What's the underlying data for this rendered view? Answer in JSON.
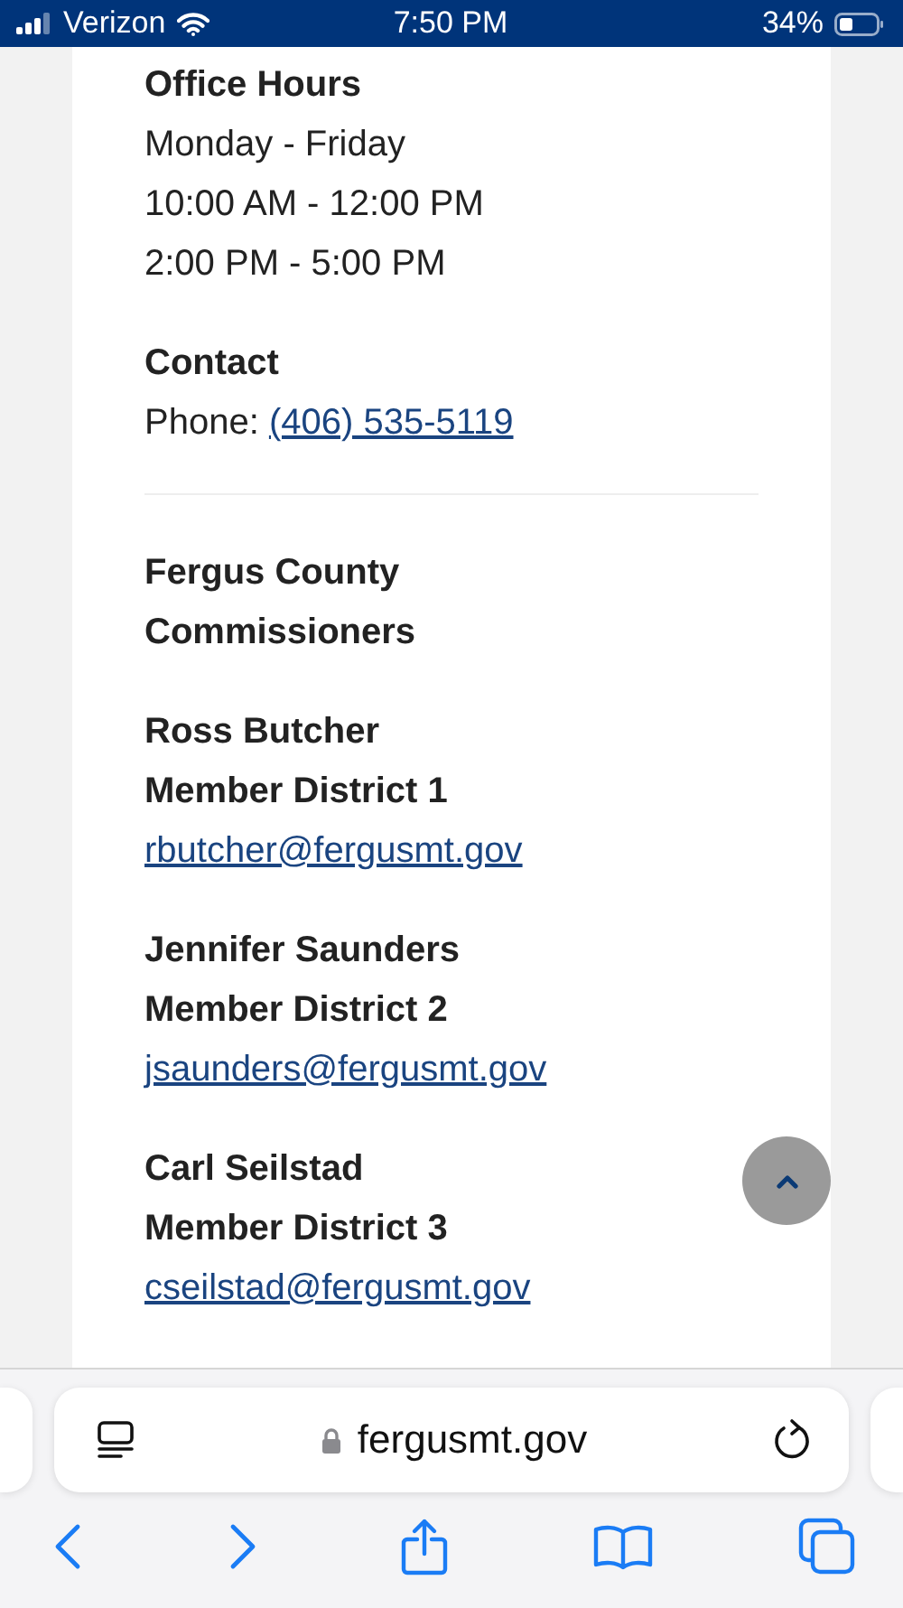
{
  "status_bar": {
    "carrier": "Verizon",
    "time": "7:50 PM",
    "battery": "34%"
  },
  "office_hours": {
    "title": "Office Hours",
    "lines": [
      "Monday - Friday",
      "10:00 AM - 12:00 PM",
      "2:00 PM - 5:00 PM"
    ]
  },
  "contact": {
    "title": "Contact",
    "label": "Phone:",
    "phone": "(406) 535-5119"
  },
  "commissioners": {
    "title_lines": [
      "Fergus County",
      "Commissioners"
    ],
    "members": [
      {
        "name": "Ross Butcher",
        "district": "Member District 1",
        "email": "rbutcher@fergusmt.gov"
      },
      {
        "name": "Jennifer Saunders",
        "district": "Member District 2",
        "email": "jsaunders@fergusmt.gov"
      },
      {
        "name": "Carl Seilstad",
        "district": "Member District 3",
        "email": "cseilstad@fergusmt.gov"
      }
    ]
  },
  "browser": {
    "url": "fergusmt.gov"
  }
}
